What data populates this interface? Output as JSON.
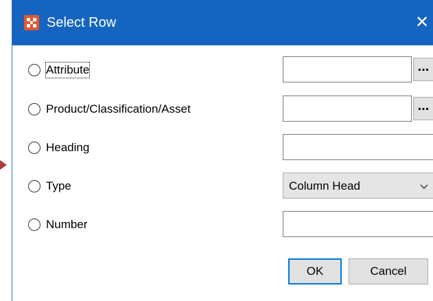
{
  "dialog": {
    "title": "Select Row",
    "close_glyph": "✕",
    "icon": "app-logo-icon"
  },
  "rows": [
    {
      "label": "Attribute",
      "selected": false,
      "control": "text-with-browse",
      "value": "",
      "browse_label": "..."
    },
    {
      "label": "Product/Classification/Asset",
      "selected": false,
      "control": "text-with-browse",
      "value": "",
      "browse_label": "..."
    },
    {
      "label": "Heading",
      "selected": false,
      "control": "text",
      "value": ""
    },
    {
      "label": "Type",
      "selected": false,
      "control": "select",
      "value": "Column Head"
    },
    {
      "label": "Number",
      "selected": false,
      "control": "text",
      "value": ""
    }
  ],
  "buttons": {
    "ok": "OK",
    "cancel": "Cancel"
  },
  "colors": {
    "titlebar": "#1565c0",
    "icon_bg": "#e4572e",
    "focus_border": "#0078d7",
    "arrow": "#b33a3a"
  }
}
